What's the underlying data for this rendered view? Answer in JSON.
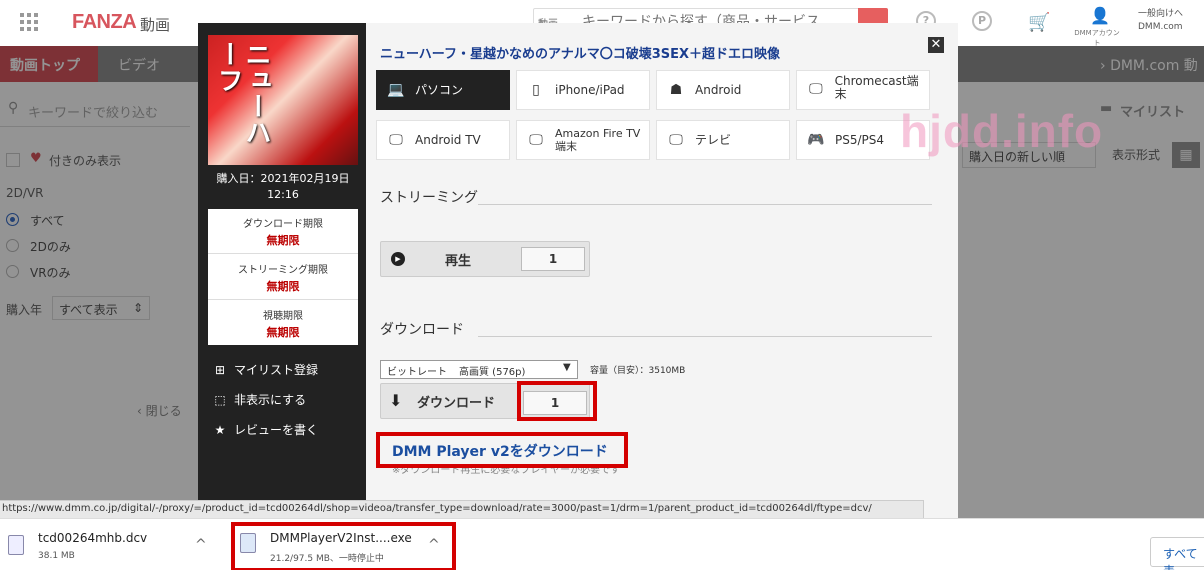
{
  "header": {
    "logo": "FANZA",
    "logo_sub": "動画",
    "search_category": "動画",
    "search_placeholder": "キーワードから探す（商品・サービス",
    "account_label": "DMMアカウント",
    "general_label_1": "一般向けへ",
    "general_label_2": "DMM.com"
  },
  "nav": {
    "top": "動画トップ",
    "video": "ビデオ",
    "dmm": "DMM.com 動"
  },
  "filter": {
    "search_placeholder": "キーワードで絞り込む",
    "fav_label": "付きのみ表示",
    "label_2dvr": "2D/VR",
    "radio_all": "すべて",
    "radio_2d": "2Dのみ",
    "radio_vr": "VRのみ",
    "label_year": "購入年",
    "year_value": "すべて表示",
    "close_label": "閉じる"
  },
  "right_panel": {
    "mylist": "マイリスト",
    "sort_value": "購入日の新しい順",
    "display_label": "表示形式"
  },
  "watermark": "hjdd.info",
  "modal": {
    "title": "ニューハーフ・星越かなめのアナルマ〇コ破壊3SEX＋超ドエロ映像",
    "thumb_text": "ニューハーフ",
    "purchase_line1": "購入日：2021年02月19日",
    "purchase_line2": "12:16",
    "info": [
      {
        "key": "ダウンロード期限",
        "value": "無期限"
      },
      {
        "key": "ストリーミング期限",
        "value": "無期限"
      },
      {
        "key": "視聴期限",
        "value": "無期限"
      }
    ],
    "actions": [
      {
        "label": "マイリスト登録",
        "icon": "folder-plus-icon"
      },
      {
        "label": "非表示にする",
        "icon": "hide-icon"
      },
      {
        "label": "レビューを書く",
        "icon": "star-icon"
      }
    ],
    "devices": [
      {
        "label": "パソコン",
        "icon": "laptop-icon",
        "selected": true
      },
      {
        "label": "iPhone/iPad",
        "icon": "phone-icon",
        "selected": false
      },
      {
        "label": "Android",
        "icon": "android-icon",
        "selected": false
      },
      {
        "label": "Chromecast端末",
        "icon": "monitor-icon",
        "selected": false
      },
      {
        "label": "Android TV",
        "icon": "monitor-icon",
        "selected": false
      },
      {
        "label": "Amazon Fire TV端末",
        "icon": "monitor-icon",
        "selected": false
      },
      {
        "label": "テレビ",
        "icon": "monitor-icon",
        "selected": false
      },
      {
        "label": "PS5/PS4",
        "icon": "gamepad-icon",
        "selected": false
      }
    ],
    "streaming_title": "ストリーミング",
    "play_label": "再生",
    "play_count": "1",
    "download_title": "ダウンロード",
    "bitrate_label": "ビットレート",
    "bitrate_value": "高画質 (576p)",
    "capacity": "容量（目安）：3510MB",
    "download_label": "ダウンロード",
    "download_count": "1",
    "dmmplayer_link": "DMM Player v2をダウンロード",
    "dmmplayer_note": "※ダウンロード再生に必要なプレイヤーが必要です"
  },
  "status_url": "https://www.dmm.co.jp/digital/-/proxy/=/product_id=tcd00264dl/shop=videoa/transfer_type=download/rate=3000/past=1/drm=1/parent_product_id=tcd00264dl/ftype=dcv/",
  "downloads": {
    "item1_name": "tcd00264mhb.dcv",
    "item1_size": "38.1 MB",
    "item2_name": "DMMPlayerV2Inst....exe",
    "item2_status": "21.2/97.5 MB、一時停止中",
    "show_all": "すべて表"
  },
  "colors": {
    "brand": "#d7555d",
    "highlight": "#d40000",
    "link": "#1b4ea0"
  }
}
